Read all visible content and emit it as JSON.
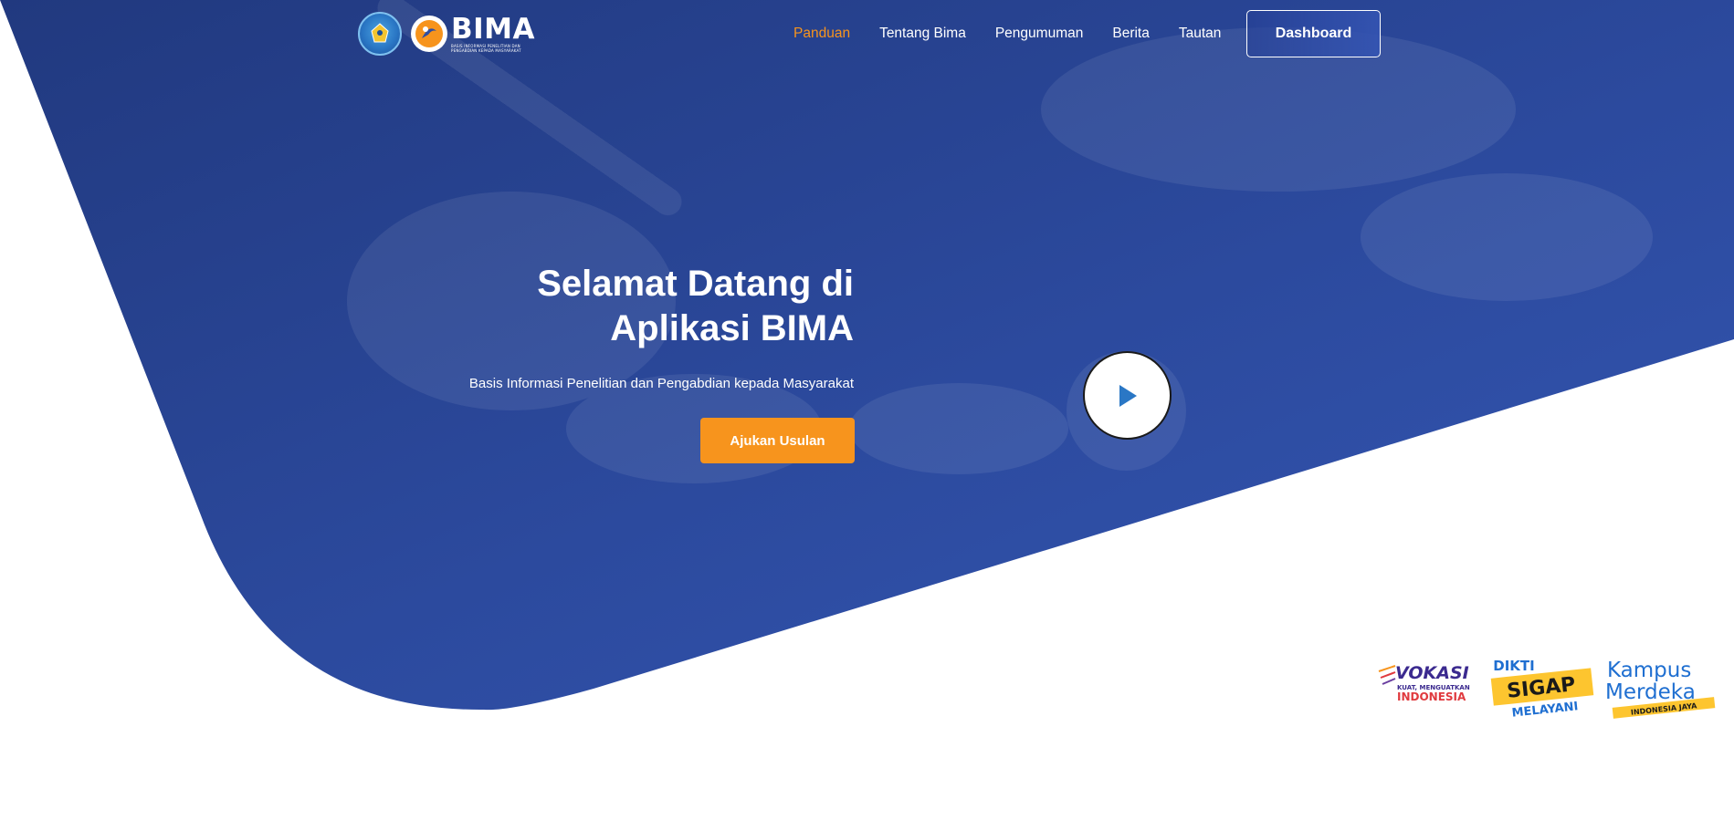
{
  "brand": {
    "name": "BIMA",
    "tagline": "BASIS INFORMASI PENELITIAN DAN PENGABDIAN KEPADA MASYARAKAT",
    "logo_icon": "tut-wuri-handayani-logo",
    "colors": {
      "primary": "#2f4ea3",
      "accent": "#f7941d",
      "text": "#ffffff"
    }
  },
  "nav": {
    "items": [
      {
        "label": "Panduan",
        "active": true
      },
      {
        "label": "Tentang Bima",
        "active": false
      },
      {
        "label": "Pengumuman",
        "active": false
      },
      {
        "label": "Berita",
        "active": false
      },
      {
        "label": "Tautan",
        "active": false
      }
    ],
    "dashboard_label": "Dashboard"
  },
  "hero": {
    "title_line1": "Selamat Datang di",
    "title_line2": "Aplikasi BIMA",
    "subtitle": "Basis Informasi Penelitian dan Pengabdian kepada Masyarakat",
    "cta_label": "Ajukan Usulan",
    "play_icon": "play-icon"
  },
  "partners": {
    "vokasi": {
      "title": "VOKASI",
      "line1": "KUAT, MENGUATKAN",
      "line2": "INDONESIA"
    },
    "dikti": {
      "top": "DIKTI",
      "main": "SIGAP",
      "bottom": "MELAYANI"
    },
    "kampus": {
      "line1": "Kampus",
      "line2": "Merdeka",
      "line3": "INDONESIA JAYA"
    }
  }
}
